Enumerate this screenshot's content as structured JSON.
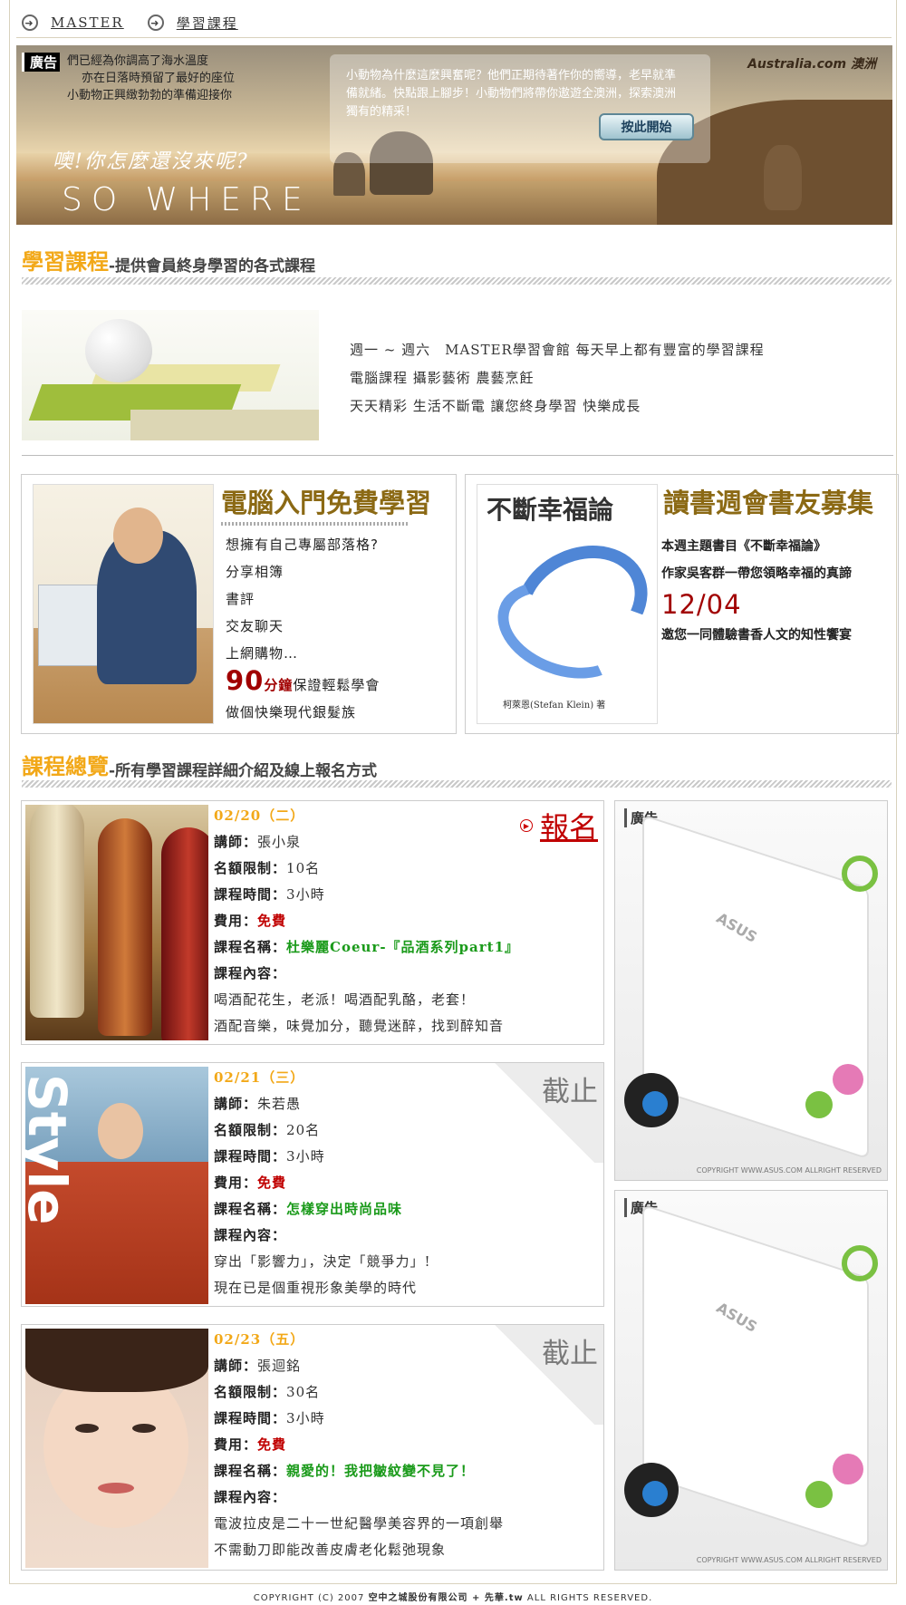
{
  "breadcrumb": {
    "home": "MASTER",
    "current": "學習課程"
  },
  "banner": {
    "ad_tag": "廣告",
    "lines": [
      "們已經為你調高了海水溫度",
      "亦在日落時預留了最好的座位",
      "小動物正興緻勃勃的準備迎接你"
    ],
    "handwriting": "噢!你怎麼還沒來呢?",
    "slogan": "SO WHERE",
    "box_text": "小動物為什麼這麼興奮呢？他們正期待著作你的嚮導，老早就準備就緒。快點跟上腳步！小動物們將帶你遨遊全澳洲，探索澳洲獨有的精采！",
    "button": "按此開始",
    "brand": "Australia.com 澳洲"
  },
  "section1": {
    "title": "學習課程",
    "subtitle": "-提供會員終身學習的各式課程"
  },
  "intro": {
    "lines": [
      "週一 ~ 週六　MASTER學習會館 每天早上都有豐富的學習課程",
      "電腦課程 攝影藝術 農藝烹飪",
      "天天精彩 生活不斷電 讓您終身學習 快樂成長"
    ]
  },
  "promo1": {
    "title": "電腦入門免費學習",
    "items": [
      "想擁有自己專屬部落格?",
      "分享相簿",
      "書評",
      "交友聊天",
      "上網購物…"
    ],
    "minutes": "90",
    "minutes_unit": "分鐘",
    "minutes_tail": "保證輕鬆學會",
    "last": "做個快樂現代銀髮族"
  },
  "promo2": {
    "title": "讀書週會書友募集",
    "book_title": "不斷幸福論",
    "book_author": "柯萊恩(Stefan Klein) 著",
    "line1": "本週主題書目《不斷幸福論》",
    "line2": "作家吳客群一帶您領略幸福的真諦",
    "date": "12/04",
    "line3": "邀您一同體驗書香人文的知性饗宴"
  },
  "section2": {
    "title": "課程總覽",
    "subtitle": "-所有學習課程詳細介紹及線上報名方式"
  },
  "labels": {
    "teacher": "講師",
    "quota": "名額限制",
    "hours": "課程時間",
    "fee": "費用",
    "name": "課程名稱",
    "content": "課程內容",
    "signup": "報名",
    "closed": "截止"
  },
  "courses": [
    {
      "date": "02/20（二）",
      "teacher": "張小泉",
      "quota": "10名",
      "hours": "3小時",
      "fee": "免費",
      "name": "杜樂麗Coeur-『品酒系列part1』",
      "content": [
        "喝酒配花生，老派！喝酒配乳酪，老套！",
        "酒配音樂，味覺加分，聽覺迷醉，找到醉知音"
      ]
    },
    {
      "date": "02/21（三）",
      "teacher": "朱若愚",
      "quota": "20名",
      "hours": "3小時",
      "fee": "免費",
      "name": "怎樣穿出時尚品味",
      "content": [
        "穿出「影響力」，決定「競爭力」!",
        "現在已是個重視形象美學的時代"
      ]
    },
    {
      "date": "02/23（五）",
      "teacher": "張迴銘",
      "quota": "30名",
      "hours": "3小時",
      "fee": "免費",
      "name": "親愛的！我把皺紋變不見了！",
      "content": [
        "電波拉皮是二十一世紀醫學美容界的一項創舉",
        "不需動刀即能改善皮膚老化鬆弛現象"
      ]
    }
  ],
  "ads": {
    "label": "廣告",
    "brand": "ASUS",
    "copyright": "COPYRIGHT WWW.ASUS.COM  ALLRIGHT RESERVED"
  },
  "footer": {
    "prefix": "COPYRIGHT (C) 2007",
    "company": "空中之城股份有限公司 + 先華.tw",
    "suffix": "ALL RIGHTS RESERVED."
  }
}
